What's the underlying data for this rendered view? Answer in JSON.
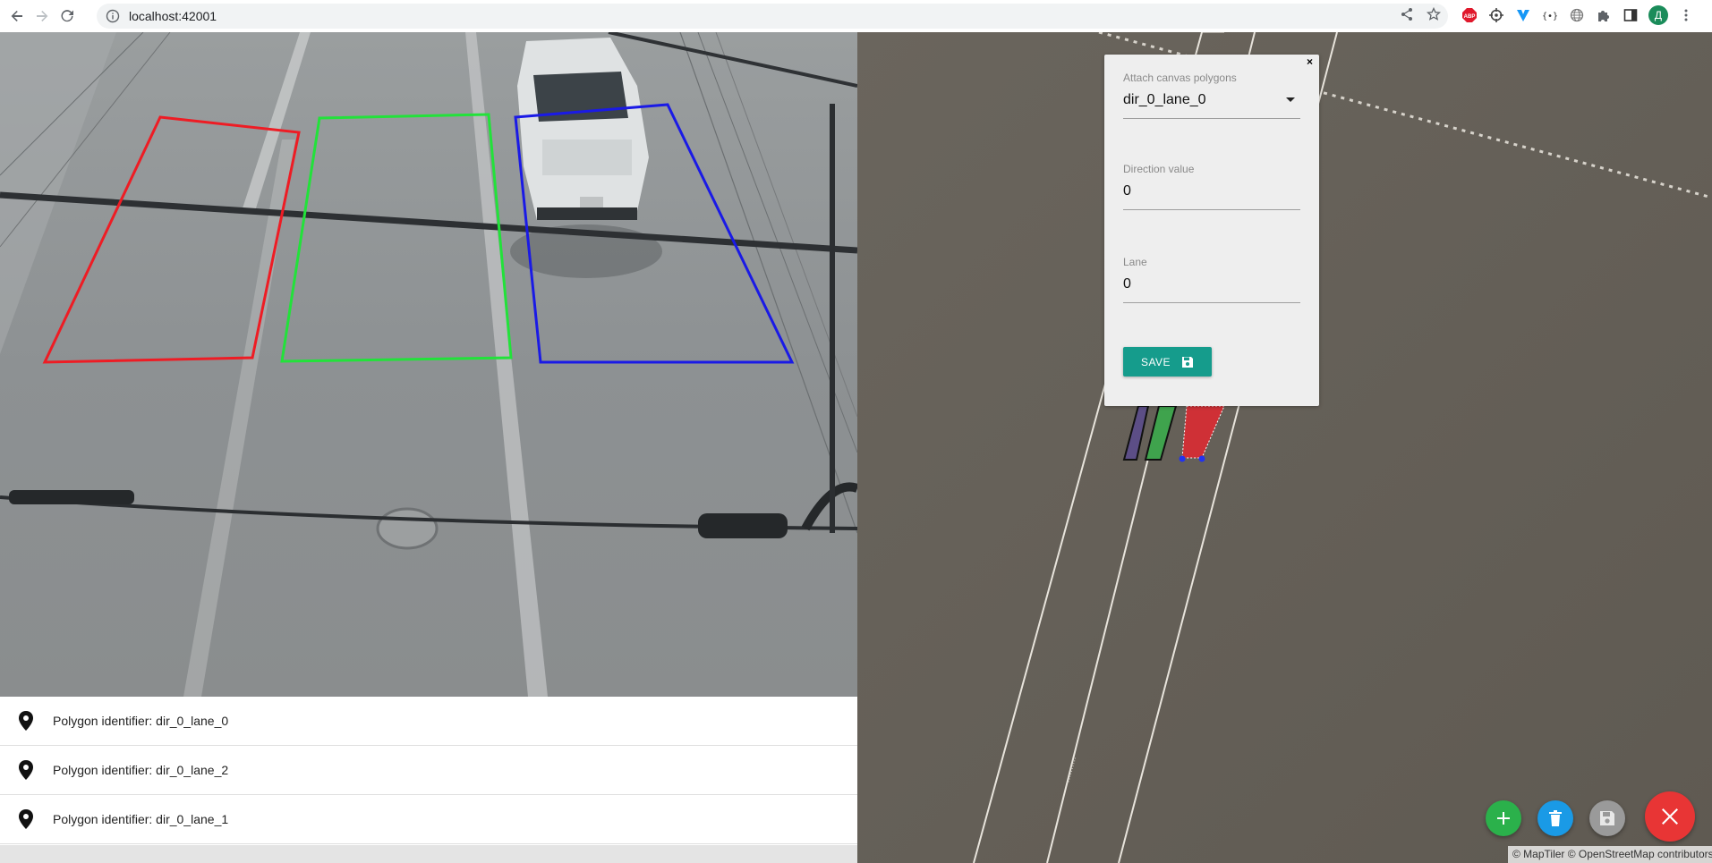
{
  "browser": {
    "url": "localhost:42001",
    "avatar_letter": "Д",
    "extensions": [
      "abp-icon",
      "crosshair-icon",
      "vuetify-icon",
      "braces-icon",
      "globe-icon",
      "puzzle-icon",
      "sidebar-icon"
    ]
  },
  "polygon_list": {
    "items": [
      {
        "label": "Polygon identifier: dir_0_lane_0"
      },
      {
        "label": "Polygon identifier: dir_0_lane_2"
      },
      {
        "label": "Polygon identifier: dir_0_lane_1"
      }
    ]
  },
  "camera_polygons": [
    {
      "id": "dir_0_lane_0",
      "color": "#ee1c24"
    },
    {
      "id": "dir_0_lane_1",
      "color": "#22e23a"
    },
    {
      "id": "dir_0_lane_2",
      "color": "#1a1ae6"
    }
  ],
  "form": {
    "close_label": "×",
    "attach_label": "Attach canvas polygons",
    "attach_value": "dir_0_lane_0",
    "direction_label": "Direction value",
    "direction_value": "0",
    "lane_label": "Lane",
    "lane_value": "0",
    "save_label": "SAVE"
  },
  "map": {
    "attribution": "© MapTiler © OpenStreetMap contributors",
    "colors": {
      "background": "#6a645c",
      "road": "#e8e4dc",
      "lane_purple": "#5c4e86",
      "lane_green": "#3fa34d",
      "lane_red": "#cf3036"
    }
  },
  "fabs": {
    "add": {
      "color": "#2bb14b"
    },
    "delete": {
      "color": "#1a9ae6"
    },
    "save": {
      "color": "#9a9a9a"
    },
    "close": {
      "color": "#e83535"
    }
  },
  "colors": {
    "accent": "#159c8c"
  }
}
